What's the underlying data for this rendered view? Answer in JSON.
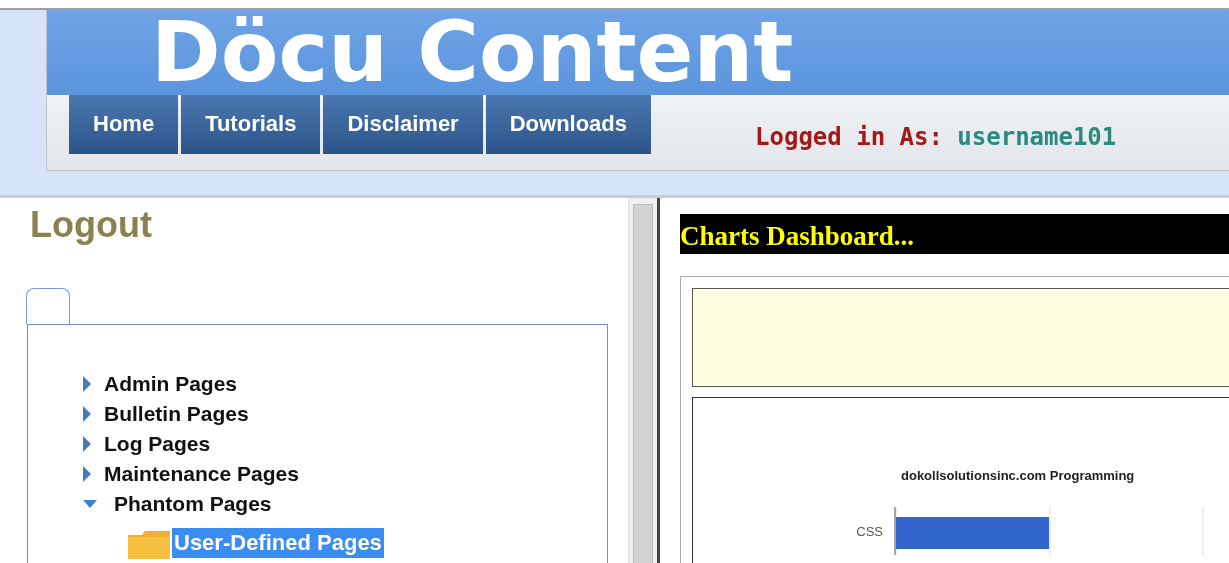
{
  "header": {
    "title": "Döcu Content",
    "nav": [
      {
        "label": "Home"
      },
      {
        "label": "Tutorials"
      },
      {
        "label": "Disclaimer"
      },
      {
        "label": "Downloads"
      }
    ],
    "login": {
      "label": "Logged in As:",
      "user": "username101"
    }
  },
  "sidebar": {
    "logout": "Logout",
    "tree": [
      {
        "label": "Admin Pages",
        "expanded": false
      },
      {
        "label": "Bulletin Pages",
        "expanded": false
      },
      {
        "label": "Log Pages",
        "expanded": false
      },
      {
        "label": "Maintenance Pages",
        "expanded": false
      },
      {
        "label": "Phantom Pages",
        "expanded": true,
        "children": [
          {
            "label": "User-Defined Pages",
            "selected": true
          }
        ]
      }
    ]
  },
  "content": {
    "heading": "Charts Dashboard...",
    "chart": {
      "title": "dokollsolutionsinc.com Programming",
      "row_labels": [
        "CSS"
      ]
    }
  }
}
